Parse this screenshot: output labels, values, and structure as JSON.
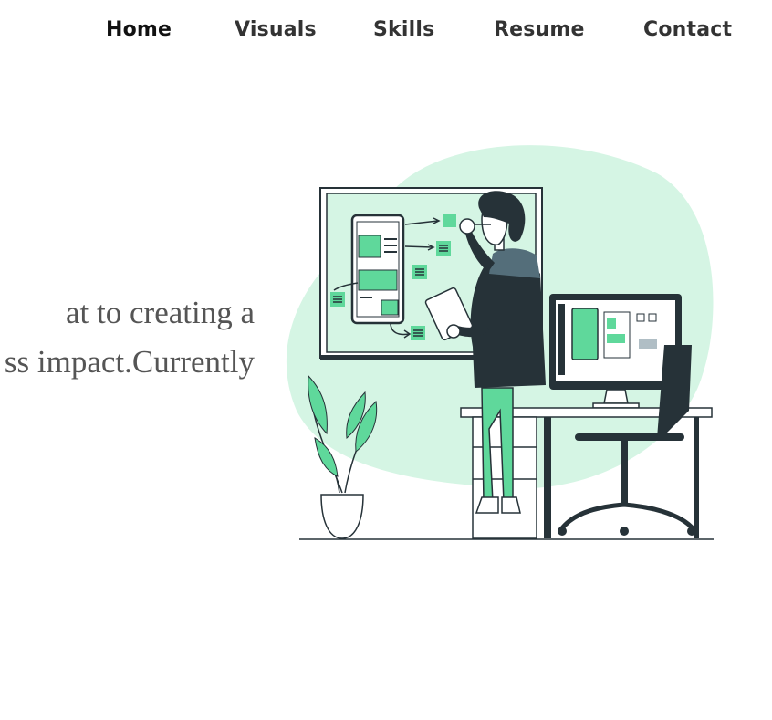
{
  "nav": {
    "items": [
      {
        "label": "Home",
        "active": true
      },
      {
        "label": "Visuals",
        "active": false
      },
      {
        "label": "Skills",
        "active": false
      },
      {
        "label": "Resume",
        "active": false
      },
      {
        "label": "Contact",
        "active": false
      }
    ]
  },
  "hero": {
    "line1": "at to creating a",
    "line2": "ss impact.Currently"
  },
  "colors": {
    "accent": "#5fd89b",
    "accent_light": "#d5f5e4",
    "dark": "#263238",
    "text": "#555555"
  }
}
